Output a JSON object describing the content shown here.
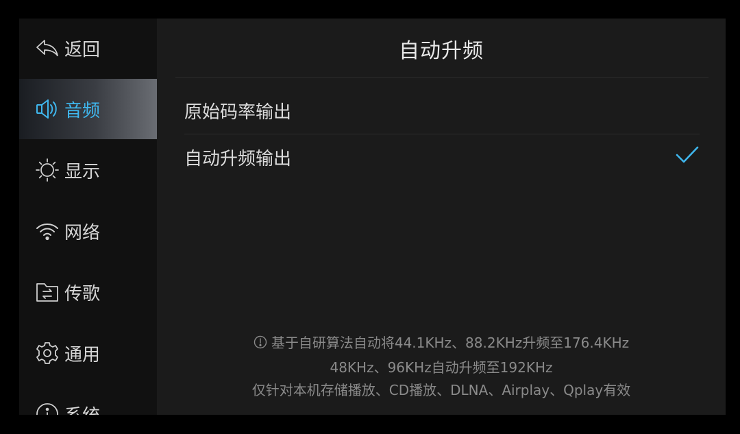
{
  "colors": {
    "accent": "#3fb7ee",
    "background": "#1b1b1b",
    "sidebar": "#111111"
  },
  "sidebar": {
    "back": {
      "label": "返回",
      "icon": "back-arrow-icon"
    },
    "items": [
      {
        "label": "音频",
        "icon": "speaker-icon",
        "active": true
      },
      {
        "label": "显示",
        "icon": "sun-icon",
        "active": false
      },
      {
        "label": "网络",
        "icon": "wifi-icon",
        "active": false
      },
      {
        "label": "传歌",
        "icon": "folder-transfer-icon",
        "active": false
      },
      {
        "label": "通用",
        "icon": "gear-icon",
        "active": false
      },
      {
        "label": "系统",
        "icon": "info-icon",
        "active": false
      }
    ]
  },
  "main": {
    "title": "自动升频",
    "options": [
      {
        "label": "原始码率输出",
        "selected": false
      },
      {
        "label": "自动升频输出",
        "selected": true
      }
    ],
    "notes": [
      "基于自研算法自动将44.1KHz、88.2KHz升频至176.4KHz",
      "48KHz、96KHz自动升频至192KHz",
      "仅针对本机存储播放、CD播放、DLNA、Airplay、Qplay有效"
    ]
  }
}
